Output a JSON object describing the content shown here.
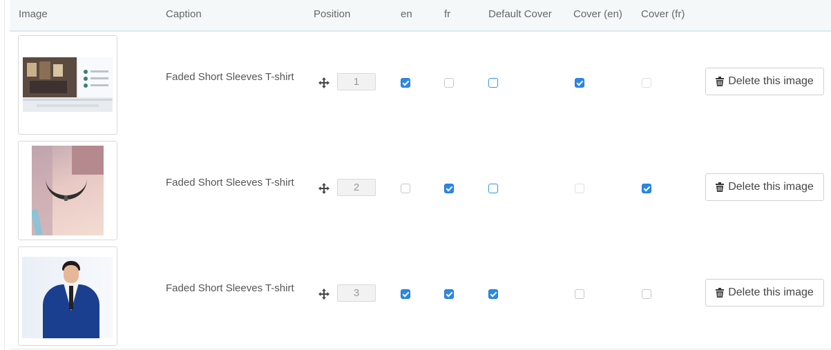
{
  "table": {
    "headers": {
      "image": "Image",
      "caption": "Caption",
      "position": "Position",
      "en": "en",
      "fr": "fr",
      "default_cover": "Default Cover",
      "cover_en": "Cover (en)",
      "cover_fr": "Cover (fr)"
    },
    "rows": [
      {
        "caption": "Faded Short Sleeves T-shirt",
        "position": "1",
        "thumbnail": "website-screenshot-image",
        "en": true,
        "fr": false,
        "default_cover": false,
        "cover_en": true,
        "cover_fr": false,
        "delete_label": "Delete this image"
      },
      {
        "caption": "Faded Short Sleeves T-shirt",
        "position": "2",
        "thumbnail": "choker-necklace-photo",
        "en": false,
        "fr": true,
        "default_cover": false,
        "cover_en": false,
        "cover_fr": true,
        "delete_label": "Delete this image"
      },
      {
        "caption": "Faded Short Sleeves T-shirt",
        "position": "3",
        "thumbnail": "man-in-suit-photo",
        "en": true,
        "fr": true,
        "default_cover": true,
        "cover_en": false,
        "cover_fr": false,
        "delete_label": "Delete this image"
      }
    ]
  },
  "icons": {
    "move": "move-arrows-icon",
    "delete": "trash-icon"
  },
  "colors": {
    "checkbox_checked": "#2b88e6",
    "default_cover_outline": "#2b9bdf",
    "header_bg": "#f5f8f9",
    "header_border": "#d6eaf3"
  }
}
